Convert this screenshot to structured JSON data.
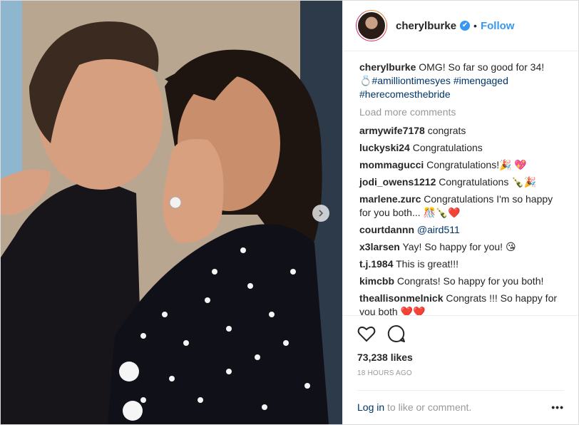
{
  "header": {
    "username": "cherylburke",
    "verified_glyph": "✔",
    "separator": "•",
    "follow_label": "Follow"
  },
  "caption": {
    "username": "cherylburke",
    "text": "OMG! So far so good for 34!",
    "ring_emoji": "💍",
    "hashtags": [
      "#amilliontimesyes",
      "#imengaged",
      "#herecomesthebride"
    ]
  },
  "load_more_label": "Load more comments",
  "comments": [
    {
      "user": "armywife7178",
      "text": "congrats"
    },
    {
      "user": "luckyski24",
      "text": "Congratulations"
    },
    {
      "user": "mommagucci",
      "text": "Congratulations!🎉 💖"
    },
    {
      "user": "jodi_owens1212",
      "text": "Congratulations 🍾🎉"
    },
    {
      "user": "marlene.zurc",
      "text": "Congratulations I'm so happy for you both... 🎊🍾❤️"
    },
    {
      "user": "courtdannn",
      "text": "",
      "mention": "@aird511"
    },
    {
      "user": "x3larsen",
      "text": "Yay! So happy for you! 😘"
    },
    {
      "user": "t.j.1984",
      "text": "This is great!!!"
    },
    {
      "user": "kimcbb",
      "text": "Congrats! So happy for you both!"
    },
    {
      "user": "theallisonmelnick",
      "text": "Congrats !!! So happy for you both ❤️❤️"
    }
  ],
  "likes": "73,238 likes",
  "time_ago": "18 HOURS AGO",
  "login": {
    "link": "Log in",
    "rest": " to like or comment."
  },
  "more_label": "•••",
  "icons": {
    "like": "heart-icon",
    "comment": "comment-icon",
    "next": "chevron-right-icon"
  }
}
